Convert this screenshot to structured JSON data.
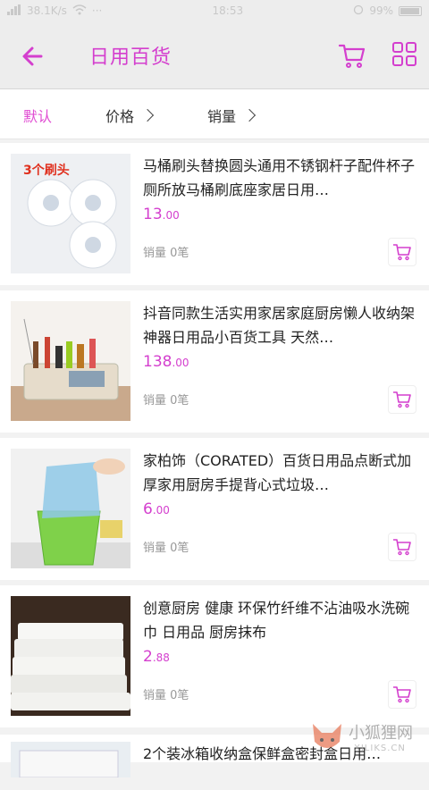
{
  "status": {
    "carrier": "38.1K/s",
    "time": "18:53",
    "battery": "99%"
  },
  "header": {
    "title": "日用百货"
  },
  "sort": {
    "default": "默认",
    "price": "价格",
    "sales": "销量"
  },
  "products": [
    {
      "title": "马桶刷头替换圆头通用不锈钢杆子配件杯子厕所放马桶刷底座家居日用…",
      "price_int": "13",
      "price_dec": ".00",
      "sales": "销量 0笔",
      "thumb_caption": "3个刷头"
    },
    {
      "title": "抖音同款生活实用家居家庭厨房懒人收纳架神器日用品小百货工具 天然…",
      "price_int": "138",
      "price_dec": ".00",
      "sales": "销量 0笔"
    },
    {
      "title": "家柏饰（CORATED）百货日用品点断式加厚家用厨房手提背心式垃圾…",
      "price_int": "6",
      "price_dec": ".00",
      "sales": "销量 0笔"
    },
    {
      "title": " 创意厨房 健康 环保竹纤维不沾油吸水洗碗巾 日用品 厨房抹布",
      "price_int": "2",
      "price_dec": ".88",
      "sales": "销量 0笔"
    },
    {
      "title": "2个装冰箱收纳盒保鲜盒密封盒日用…"
    }
  ],
  "watermark": {
    "text": "小狐狸网",
    "sub": "XILIKS.CN"
  },
  "colors": {
    "accent": "#d43fce",
    "header_bg": "#ededed"
  }
}
